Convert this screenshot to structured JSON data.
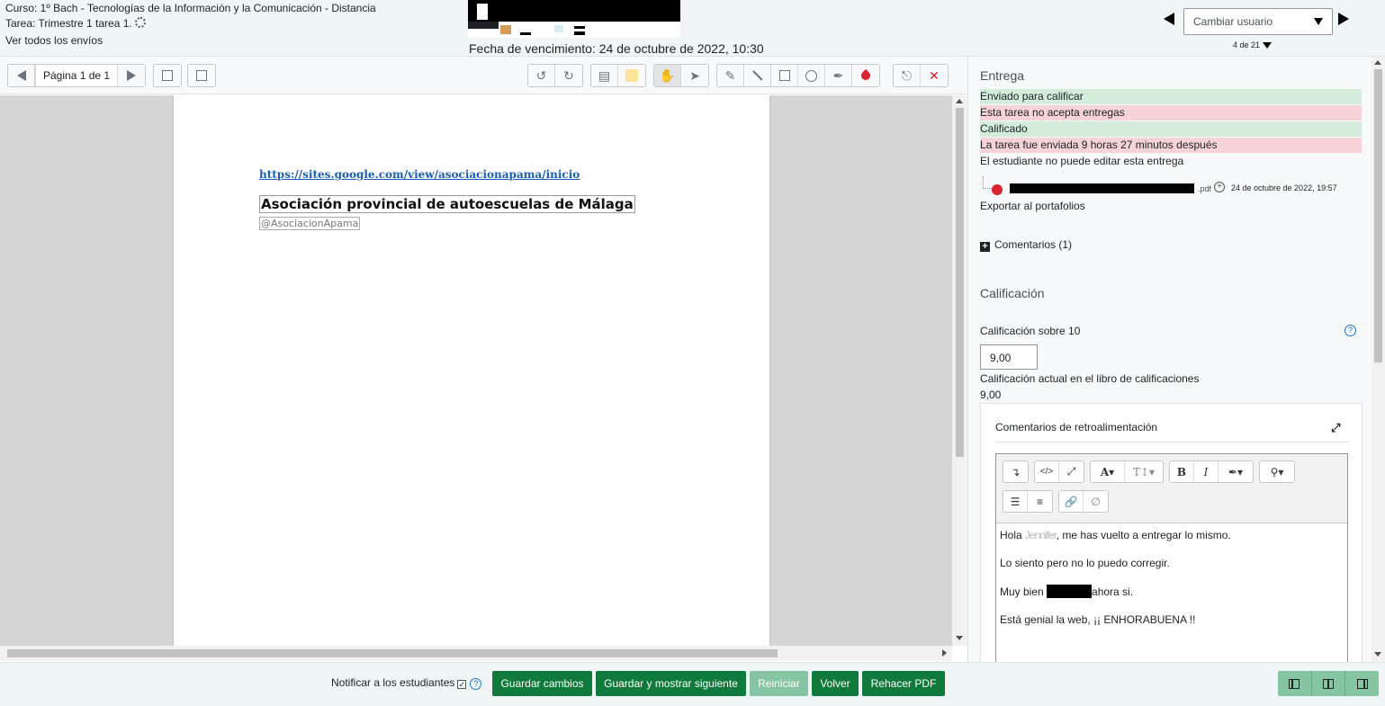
{
  "header": {
    "course": "Curso: 1º Bach - Tecnologías de la Información y la Comunicación - Distancia",
    "task": "Tarea: Trimestre 1 tarea 1.",
    "view_all": "Ver todos los envíos",
    "due_date": "Fecha de vencimiento: 24 de octubre de 2022, 10:30",
    "user_select_placeholder": "Cambiar usuario",
    "user_count": "4 de 21"
  },
  "toolbar": {
    "page_label": "Página 1 de 1",
    "icons": [
      "prev-page-icon",
      "next-page-icon",
      "search-comments-icon",
      "expand-comments-icon",
      "rotate-left-icon",
      "rotate-right-icon",
      "comment-icon",
      "comment-color-icon",
      "pan-icon",
      "select-icon",
      "pen-icon",
      "line-icon",
      "rectangle-icon",
      "oval-icon",
      "highlight-icon",
      "color-icon",
      "stamp-icon",
      "delete-icon"
    ]
  },
  "document": {
    "link": "https://sites.google.com/view/asociacionapama/inicio",
    "title": "Asociación provincial de autoescuelas de Málaga",
    "handle": "@AsociacionApama"
  },
  "panel": {
    "submission_title": "Entrega",
    "statuses": [
      {
        "text": "Enviado para calificar",
        "kind": "green"
      },
      {
        "text": "Esta tarea no acepta entregas",
        "kind": "red"
      },
      {
        "text": "Calificado",
        "kind": "green"
      },
      {
        "text": "La tarea fue enviada 9 horas 27 minutos después",
        "kind": "red"
      },
      {
        "text": "El estudiante no puede editar esta entrega",
        "kind": "plain"
      }
    ],
    "file_ext": ".pdf",
    "file_date": "24 de octubre de 2022, 19:57",
    "export": "Exportar al portafolios",
    "comments": "Comentarios (1)",
    "grade_title": "Calificación",
    "grade_label": "Calificación sobre 10",
    "grade_value": "9,00",
    "gradebook_label": "Calificación actual en el libro de calificaciones",
    "gradebook_value": "9,00",
    "feedback_title": "Comentarios de retroalimentación",
    "feedback": {
      "greeting_pre": "Hola ",
      "greeting_name": "Jennifer",
      "greeting_post": ", me has vuelto a entregar lo mismo.",
      "line2": "Lo siento pero no lo puedo corregir.",
      "line3_pre": "Muy bien ",
      "line3_post": "ahora si.",
      "line4": "Está genial la web, ¡¡ ENHORABUENA !!"
    }
  },
  "footer": {
    "notify": "Notificar a los estudiantes",
    "save": "Guardar cambios",
    "save_next": "Guardar y mostrar siguiente",
    "reset": "Reiniciar",
    "back": "Volver",
    "redo_pdf": "Rehacer PDF"
  },
  "colors": {
    "accent_green": "#0f7a3c",
    "status_green": "#d4edda",
    "status_red": "#f5d3d6",
    "link_blue": "#1a5fb4"
  }
}
